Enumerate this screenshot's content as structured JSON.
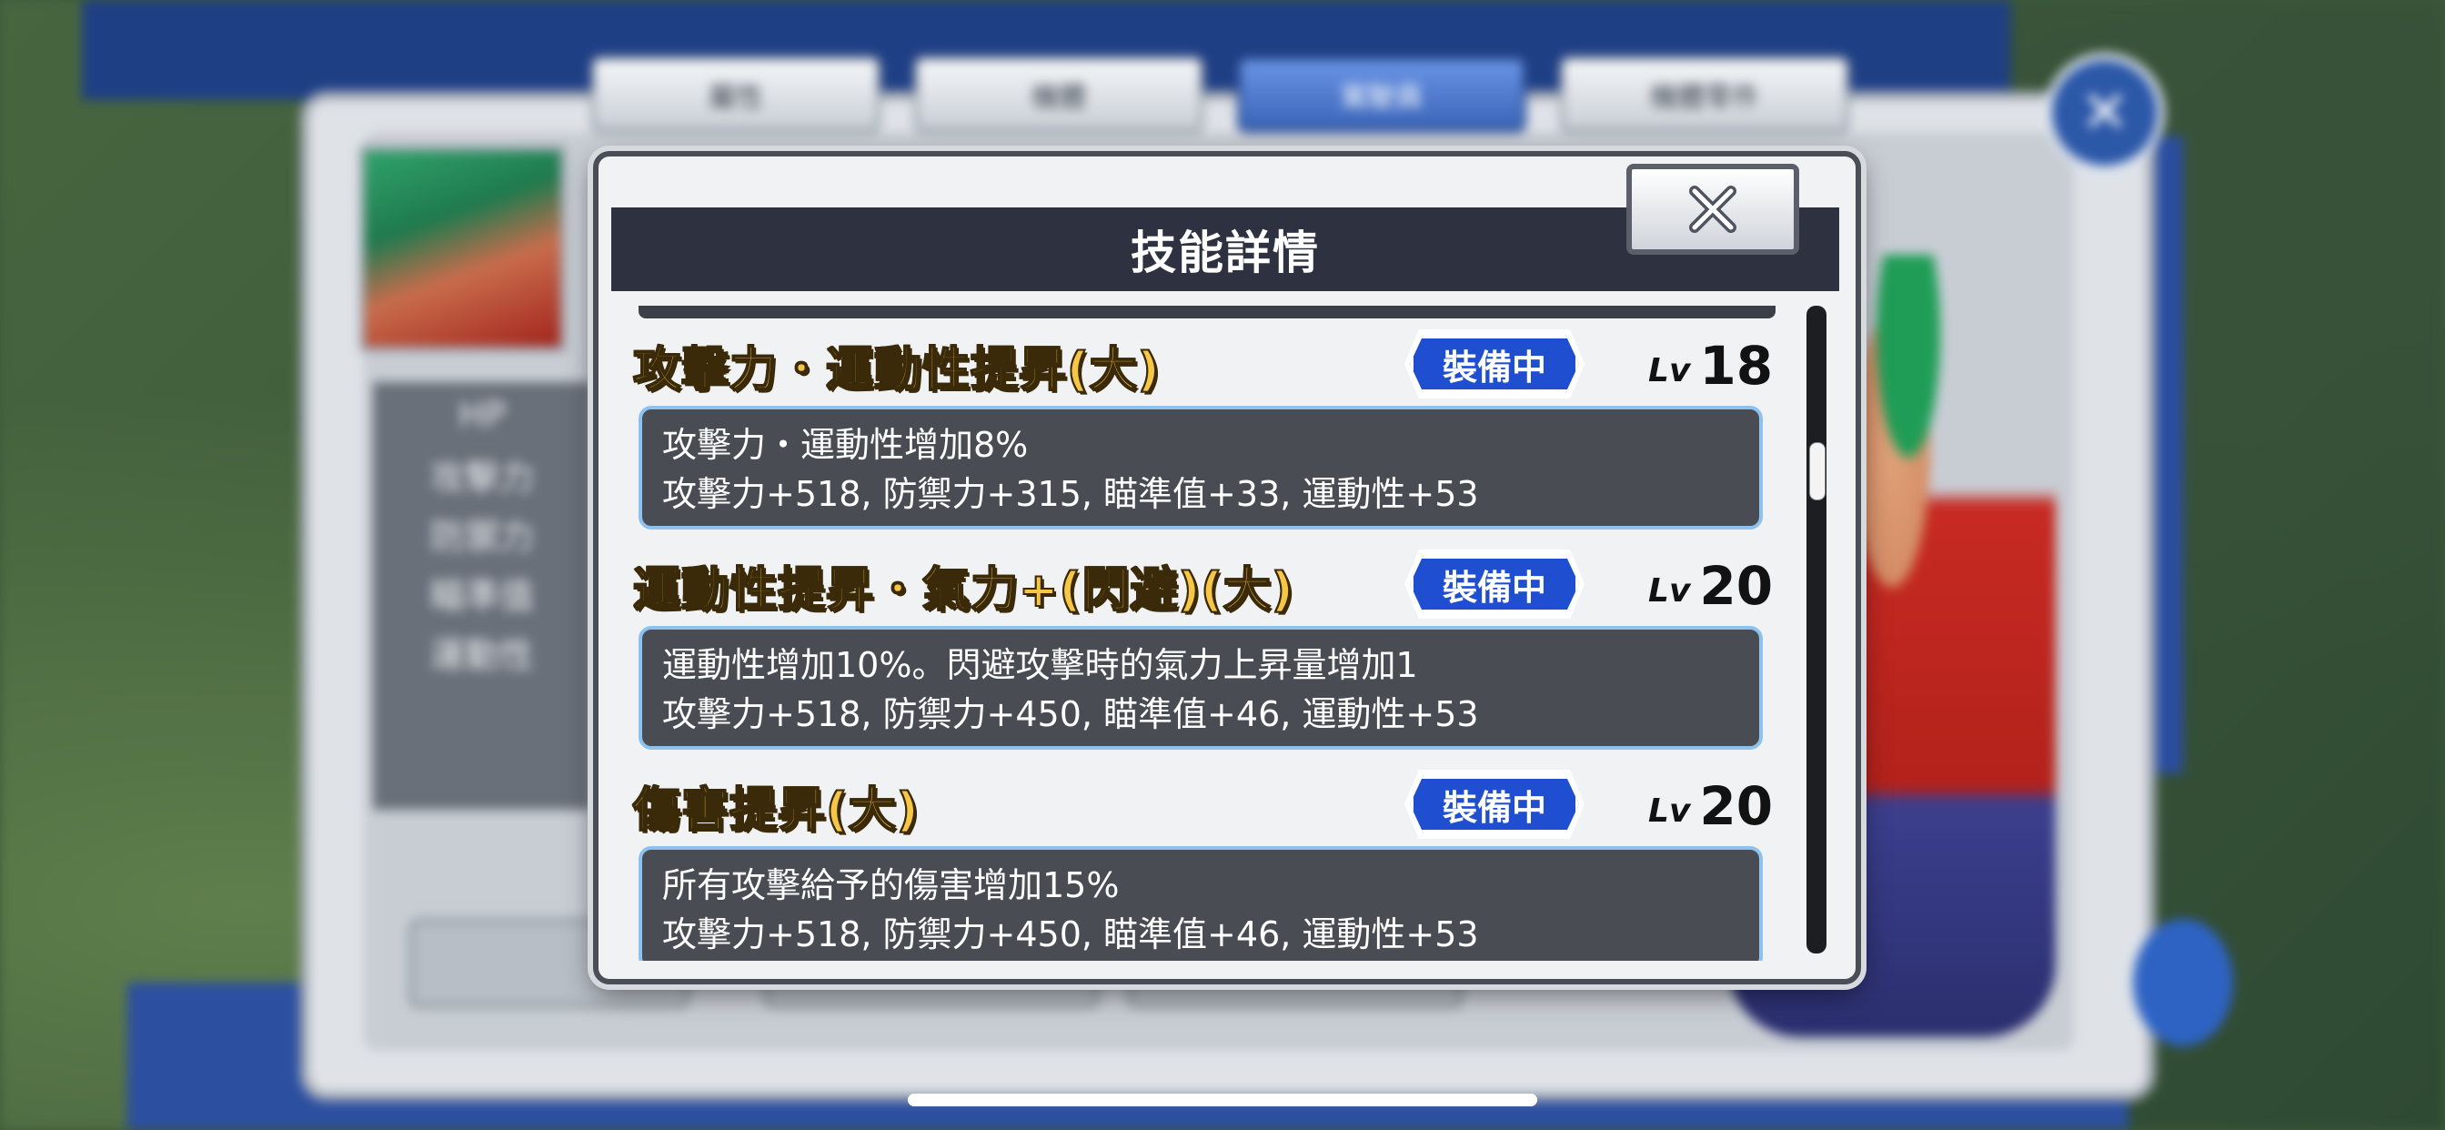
{
  "background": {
    "tabs": [
      "屬性",
      "機體",
      "駕駛員",
      "機體零件"
    ],
    "active_tab_index": 2,
    "stats": [
      "HP",
      "攻擊力",
      "防禦力",
      "瞄準值",
      "運動性"
    ]
  },
  "modal": {
    "title": "技能詳情",
    "skills": [
      {
        "name": "攻擊力・運動性提昇(大)",
        "badge": "裝備中",
        "lv_label": "Lv",
        "level": "18",
        "effect": "攻擊力・運動性增加8%",
        "stats": "攻擊力+518, 防禦力+315, 瞄準值+33, 運動性+53"
      },
      {
        "name": "運動性提昇・氣力+(閃避)(大)",
        "badge": "裝備中",
        "lv_label": "Lv",
        "level": "20",
        "effect": "運動性增加10%。閃避攻擊時的氣力上昇量增加1",
        "stats": "攻擊力+518, 防禦力+450, 瞄準值+46, 運動性+53"
      },
      {
        "name": "傷害提昇(大)",
        "badge": "裝備中",
        "lv_label": "Lv",
        "level": "20",
        "effect": "所有攻擊給予的傷害增加15%",
        "stats": "攻擊力+518, 防禦力+450, 瞄準值+46, 運動性+53"
      }
    ]
  },
  "icons": {
    "modal_close": "close-icon",
    "bg_close": "close-circle-icon"
  },
  "colors": {
    "skill_name": "#f6c646",
    "badge": "#1f4fd0",
    "header": "#2e3240",
    "desc_bg": "#4a4c53",
    "desc_border": "#8dc2ef"
  }
}
